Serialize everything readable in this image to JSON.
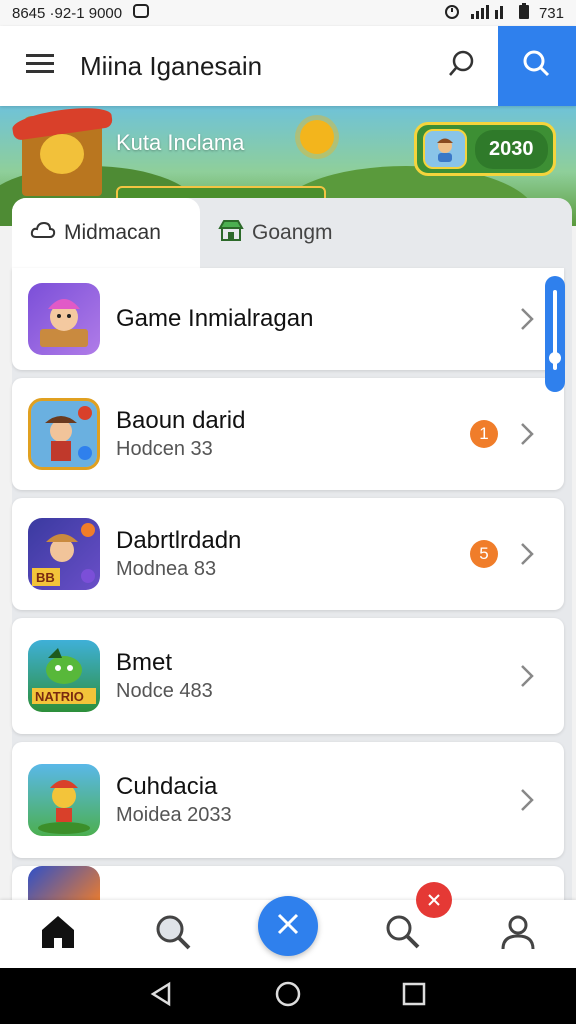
{
  "status_bar": {
    "left_text": "8645 ·92-1 9000",
    "right_text": "731"
  },
  "app_bar": {
    "title": "Miina Iganesain"
  },
  "banner": {
    "title": "Kuta Inclama",
    "score": "2030"
  },
  "tabs": [
    {
      "label": "Midmacan",
      "icon": "cloud-icon"
    },
    {
      "label": "Goangm",
      "icon": "store-icon"
    }
  ],
  "list": [
    {
      "title": "Game Inmialragan",
      "subtitle": "",
      "badge": ""
    },
    {
      "title": "Baoun darid",
      "subtitle": "Hodcen 33",
      "badge": "1"
    },
    {
      "title": "Dabrtlrdadn",
      "subtitle": "Modnea 83",
      "badge": "5"
    },
    {
      "title": "Bmet",
      "subtitle": "Nodce 483",
      "badge": ""
    },
    {
      "title": "Cuhdacia",
      "subtitle": "Moidea 2033",
      "badge": ""
    }
  ],
  "colors": {
    "accent": "#2f80ed",
    "badge_orange": "#f07d2a",
    "badge_red": "#e53935"
  }
}
